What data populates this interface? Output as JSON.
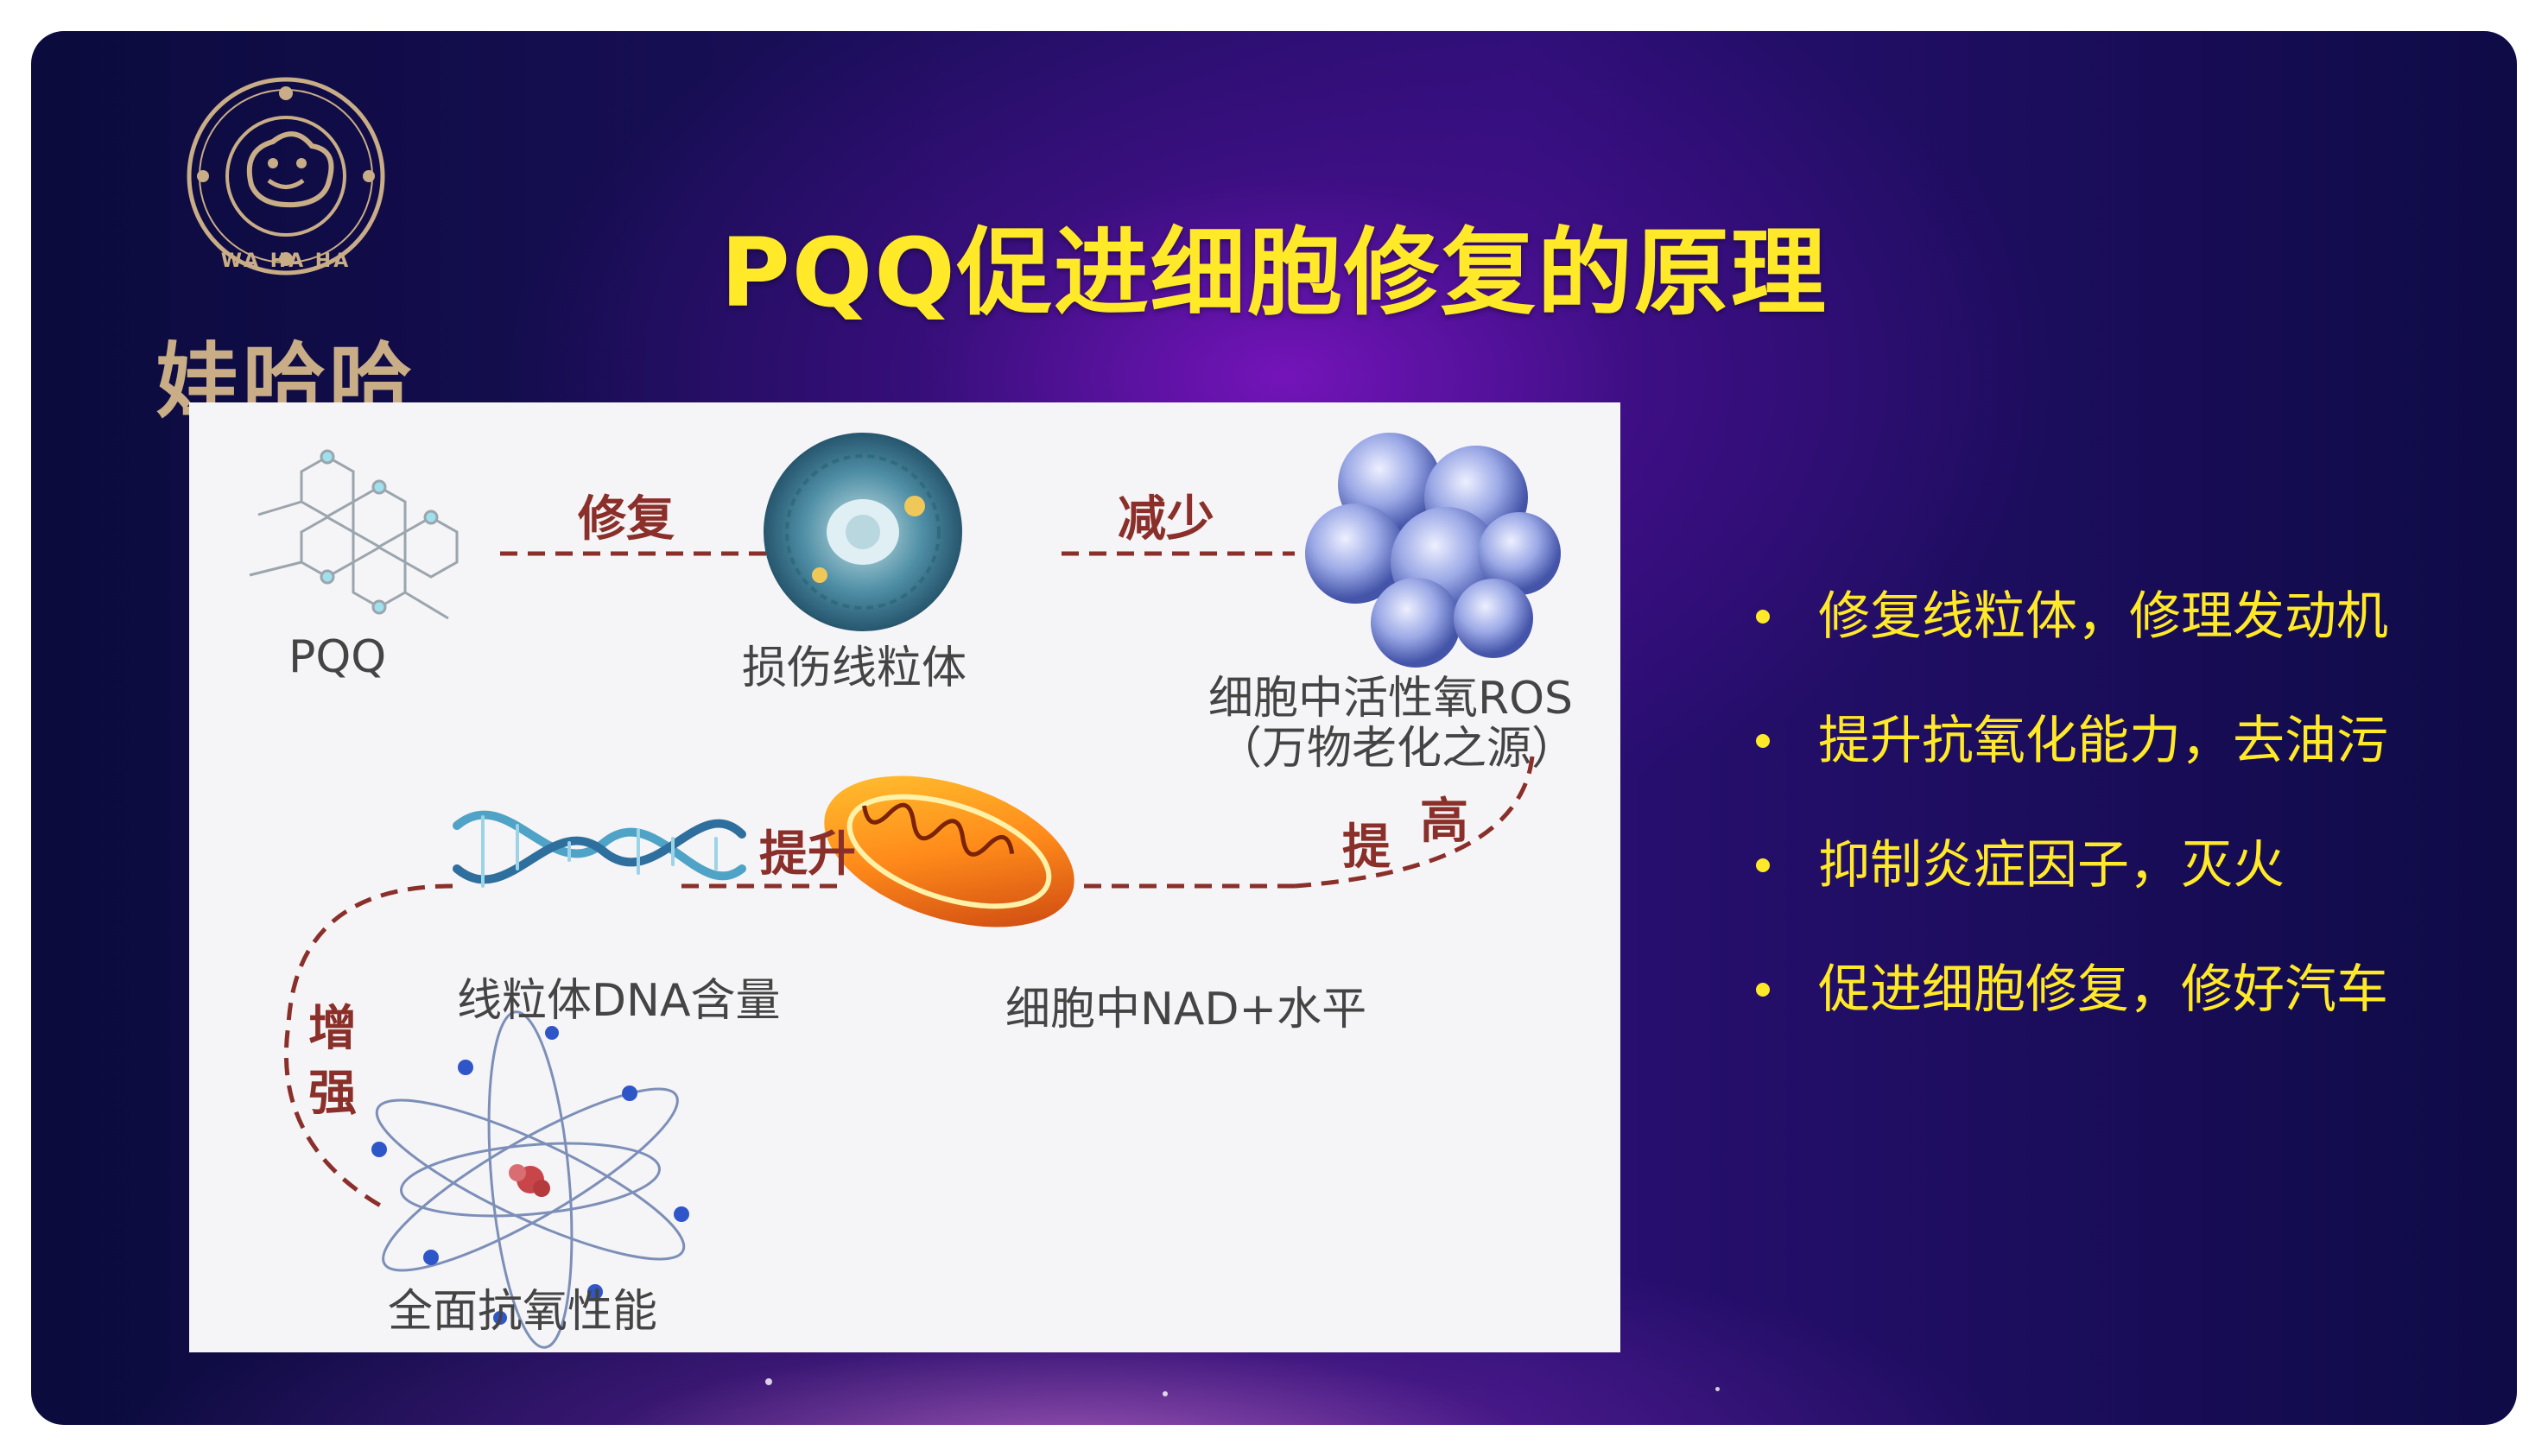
{
  "title": "PQQ促进细胞修复的原理",
  "logo": {
    "brand_text": "娃哈哈",
    "ring_text": "WA HA HA"
  },
  "diagram": {
    "nodes": {
      "pqq": "PQQ",
      "damaged_mito": "损伤线粒体",
      "ros_line1": "细胞中活性氧ROS",
      "ros_line2": "（万物老化之源）",
      "mito_dna": "线粒体DNA含量",
      "nad": "细胞中NAD+水平",
      "antioxidant": "全面抗氧性能"
    },
    "relations": {
      "repair": "修复",
      "reduce": "减少",
      "raise_1": "提",
      "raise_2": "高",
      "boost": "提升",
      "enhance_1": "增",
      "enhance_2": "强"
    }
  },
  "bullets": [
    "修复线粒体，修理发动机",
    "提升抗氧化能力，去油污",
    "抑制炎症因子，灭火",
    "促进细胞修复，修好汽车"
  ],
  "colors": {
    "title": "#ffe928",
    "bullet": "#ffe928",
    "connector": "#8a2f2a",
    "panel": "#f5f4f6"
  }
}
